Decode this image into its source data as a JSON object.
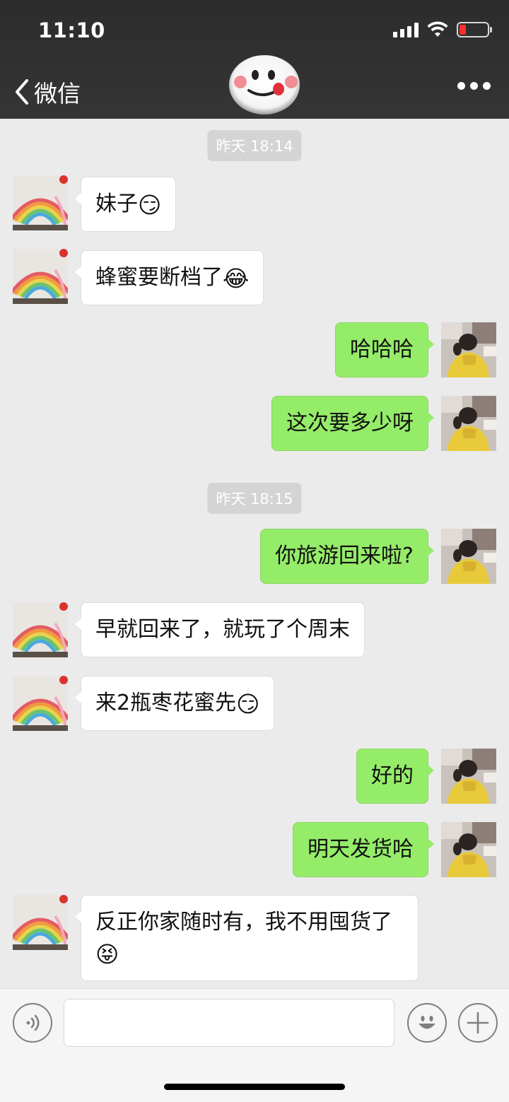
{
  "status_bar": {
    "time": "11:10"
  },
  "nav": {
    "back_label": "微信"
  },
  "messages": [
    {
      "type": "time",
      "text": "昨天 18:14"
    },
    {
      "type": "in",
      "text": "妹子",
      "emoji": "😏"
    },
    {
      "type": "in",
      "text": "蜂蜜要断档了",
      "emoji": "😂"
    },
    {
      "type": "out",
      "text": "哈哈哈"
    },
    {
      "type": "out",
      "text": "这次要多少呀"
    },
    {
      "type": "time",
      "text": "昨天 18:15"
    },
    {
      "type": "out",
      "text": "你旅游回来啦?"
    },
    {
      "type": "in",
      "text": "早就回来了，就玩了个周末"
    },
    {
      "type": "in",
      "text": "来2瓶枣花蜜先",
      "emoji": "😏"
    },
    {
      "type": "out",
      "text": "好的"
    },
    {
      "type": "out",
      "text": "明天发货哈"
    },
    {
      "type": "in",
      "text": "反正你家随时有，我不用囤货了",
      "emoji": "😝"
    }
  ],
  "input": {
    "value": ""
  },
  "icons": {
    "back": "chevron-left-icon",
    "more": "more-dots-icon",
    "voice": "voice-icon",
    "emoji": "emoji-smile-icon",
    "plus": "plus-icon"
  },
  "colors": {
    "header_bg": "#2e2e2e",
    "chat_bg": "#ebebeb",
    "outgoing_bubble": "#95ec69",
    "incoming_bubble": "#ffffff",
    "battery_low": "#ff2d2d"
  }
}
